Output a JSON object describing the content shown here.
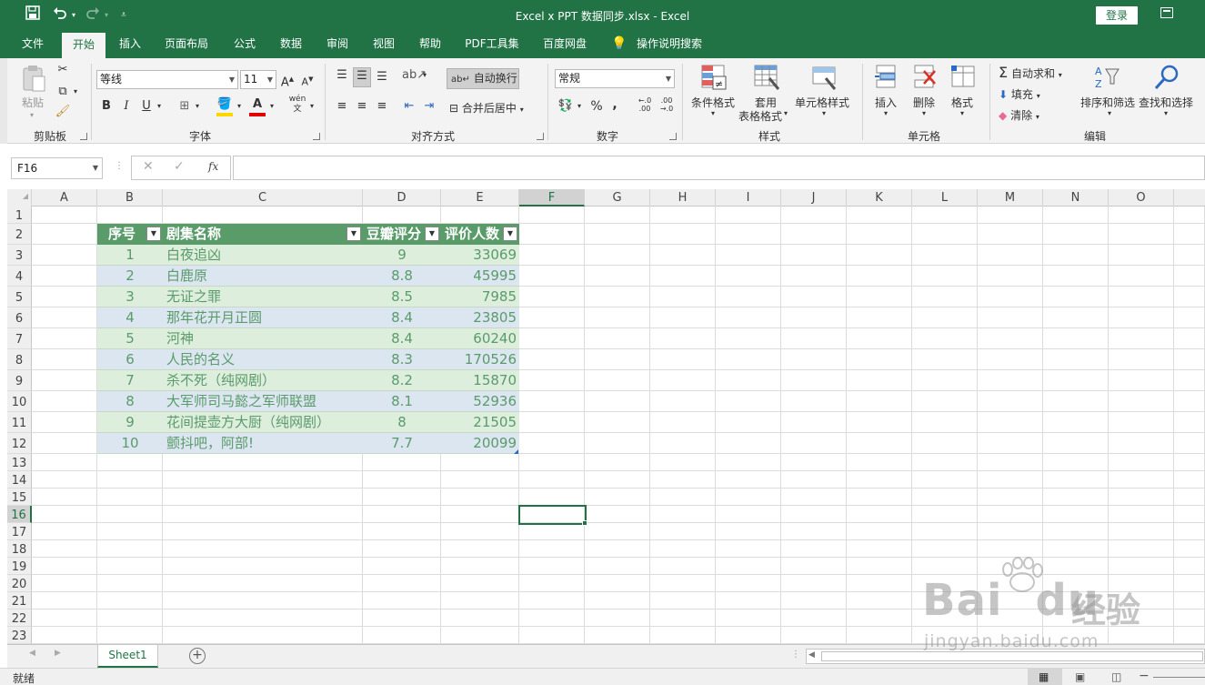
{
  "window": {
    "title": "Excel x PPT 数据同步.xlsx  -  Excel",
    "login": "登录"
  },
  "qat": {
    "save_icon": "save-icon",
    "undo_icon": "undo-icon",
    "redo_icon": "redo-icon",
    "customize_icon": "customize-qat-icon"
  },
  "tabs": [
    "文件",
    "开始",
    "插入",
    "页面布局",
    "公式",
    "数据",
    "审阅",
    "视图",
    "帮助",
    "PDF工具集",
    "百度网盘",
    "操作说明搜索"
  ],
  "active_tab": "开始",
  "ribbon": {
    "clipboard": {
      "label": "剪贴板",
      "paste": "粘贴"
    },
    "font": {
      "label": "字体",
      "font_name": "等线",
      "font_size": "11",
      "bold": "B",
      "italic": "I",
      "underline": "U",
      "grow": "A",
      "shrink": "A",
      "wen": "wén",
      "font_color_letter": "A"
    },
    "alignment": {
      "label": "对齐方式",
      "wrap_text": "自动换行",
      "merge_center": "合并后居中"
    },
    "number": {
      "label": "数字",
      "format": "常规",
      "percent": "%",
      "comma": ",",
      "inc_decimal": "←.0\n.00",
      "dec_decimal": ".00\n→.0"
    },
    "styles": {
      "label": "样式",
      "conditional": "条件格式",
      "table_format_1": "套用",
      "table_format_2": "表格格式",
      "cell_styles": "单元格样式"
    },
    "cells": {
      "label": "单元格",
      "insert": "插入",
      "delete": "删除",
      "format": "格式"
    },
    "editing": {
      "label": "编辑",
      "autosum": "自动求和",
      "fill": "填充",
      "clear": "清除",
      "sort_filter": "排序和筛选",
      "find_select": "查找和选择"
    }
  },
  "formula_bar": {
    "name_box": "F16",
    "fx": "fx",
    "value": ""
  },
  "columns": [
    "A",
    "B",
    "C",
    "D",
    "E",
    "F",
    "G",
    "H",
    "I",
    "J",
    "K",
    "L",
    "M",
    "N",
    "O"
  ],
  "selected_column": "F",
  "rows": [
    "1",
    "2",
    "3",
    "4",
    "5",
    "6",
    "7",
    "8",
    "9",
    "10",
    "11",
    "12",
    "13",
    "14",
    "15",
    "16",
    "17",
    "18",
    "19",
    "20",
    "21",
    "22",
    "23"
  ],
  "selected_row": "16",
  "table": {
    "headers": [
      "序号",
      "剧集名称",
      "豆瓣评分",
      "评价人数"
    ],
    "rows": [
      [
        "1",
        "白夜追凶",
        "9",
        "33069"
      ],
      [
        "2",
        "白鹿原",
        "8.8",
        "45995"
      ],
      [
        "3",
        "无证之罪",
        "8.5",
        "7985"
      ],
      [
        "4",
        "那年花开月正圆",
        "8.4",
        "23805"
      ],
      [
        "5",
        "河神",
        "8.4",
        "60240"
      ],
      [
        "6",
        "人民的名义",
        "8.3",
        "170526"
      ],
      [
        "7",
        "杀不死（纯网剧）",
        "8.2",
        "15870"
      ],
      [
        "8",
        "大军师司马懿之军师联盟",
        "8.1",
        "52936"
      ],
      [
        "9",
        "花间提壶方大厨（纯网剧）",
        "8",
        "21505"
      ],
      [
        "10",
        "颤抖吧，阿部!",
        "7.7",
        "20099"
      ]
    ]
  },
  "sheets": [
    "Sheet1"
  ],
  "status": {
    "ready": "就绪"
  },
  "watermark": {
    "brand": "Bai",
    "brand2": "du",
    "brand_cn": "经验",
    "url": "jingyan.baidu.com"
  },
  "colors": {
    "accent": "#217346",
    "table_header": "#5a9b6a",
    "band_green": "#ddeedd",
    "band_blue": "#dce6f0"
  }
}
